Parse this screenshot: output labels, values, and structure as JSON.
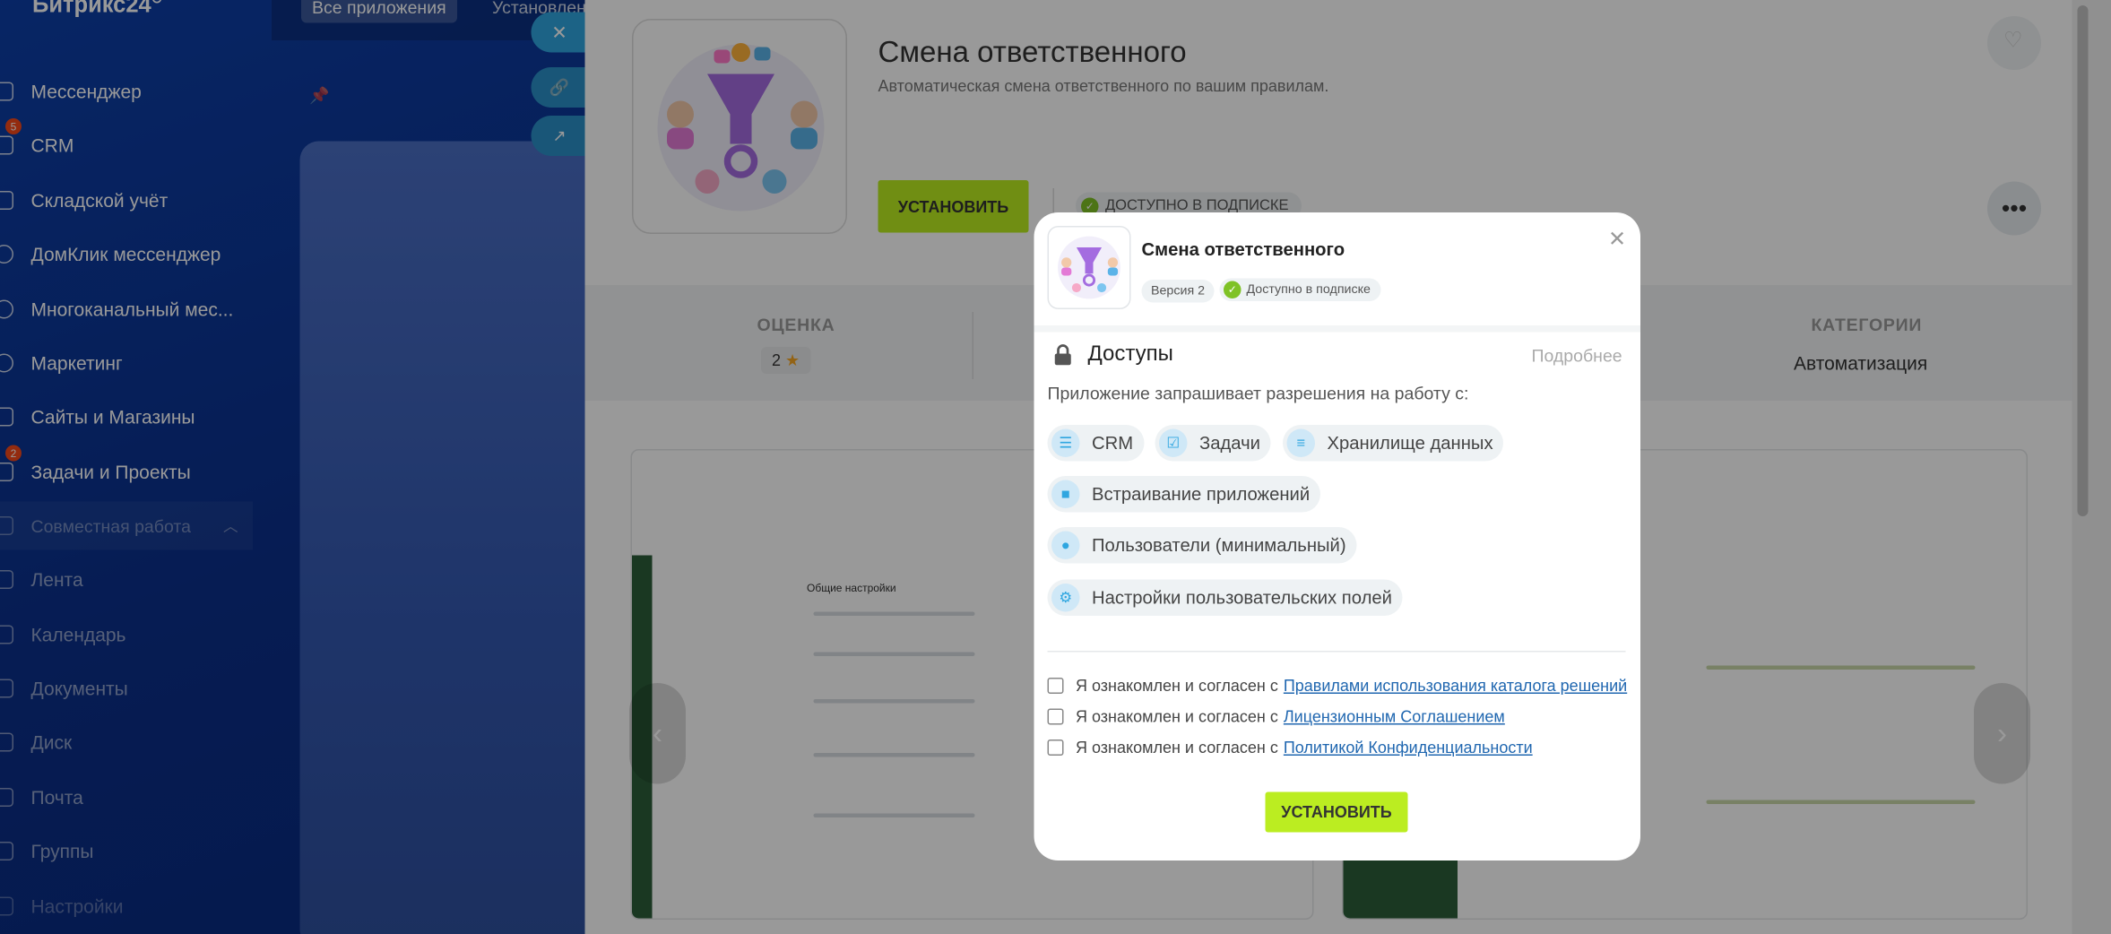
{
  "sidebar": {
    "logo": "Битрикс24",
    "items": [
      {
        "label": "Мессенджер",
        "badge": ""
      },
      {
        "label": "CRM",
        "badge": "5"
      },
      {
        "label": "Складской учёт",
        "badge": ""
      },
      {
        "label": "ДомКлик мессенджер",
        "badge": ""
      },
      {
        "label": "Многоканальный мес...",
        "badge": ""
      },
      {
        "label": "Маркетинг",
        "badge": ""
      },
      {
        "label": "Сайты и Магазины",
        "badge": ""
      },
      {
        "label": "Задачи и Проекты",
        "badge": "2"
      }
    ],
    "group_label": "Совместная работа",
    "group_items": [
      "Лента",
      "Календарь",
      "Документы",
      "Диск",
      "Почта",
      "Группы",
      "Настройки"
    ]
  },
  "topbar": {
    "tab_all": "Все приложения",
    "tab_installed": "Установлен"
  },
  "app_page": {
    "title": "Смена ответственного",
    "description": "Автоматическая смена ответственного по вашим правилам.",
    "install_label": "УСТАНОВИТЬ",
    "availability": "ДОСТУПНО В ПОДПИСКЕ",
    "rating_heading": "ОЦЕНКА",
    "rating_value": "2",
    "categories_heading": "КАТЕГОРИИ",
    "categories_value": "Автоматизация",
    "shot_title": "Общие настройки"
  },
  "modal": {
    "title": "Смена ответственного",
    "version": "Версия 2",
    "subscription": "Доступно в подписке",
    "access_heading": "Доступы",
    "more_link": "Подробнее",
    "request_text": "Приложение запрашивает разрешения на работу с:",
    "permissions": [
      "CRM",
      "Задачи",
      "Хранилище данных",
      "Встраивание приложений",
      "Пользователи (минимальный)",
      "Настройки пользовательских полей"
    ],
    "agreements": [
      {
        "prefix": "Я ознакомлен и согласен с",
        "link": "Правилами использования каталога решений"
      },
      {
        "prefix": "Я ознакомлен и согласен с",
        "link": "Лицензионным Соглашением"
      },
      {
        "prefix": "Я ознакомлен и согласен с",
        "link": "Политикой Конфиденциальности"
      }
    ],
    "install_label": "УСТАНОВИТЬ"
  },
  "icons": {
    "close": "close-icon",
    "link": "link-icon",
    "open": "external-link-icon",
    "pin": "pin-icon",
    "heart": "heart-icon",
    "more": "more-icon",
    "lock": "lock-icon",
    "check": "check-icon",
    "star": "star-icon"
  },
  "colors": {
    "accent_green": "#bbed21",
    "link_blue": "#2067b0",
    "sidebar_blue": "#0a2f8a",
    "side_button": "#2fa6e0"
  }
}
